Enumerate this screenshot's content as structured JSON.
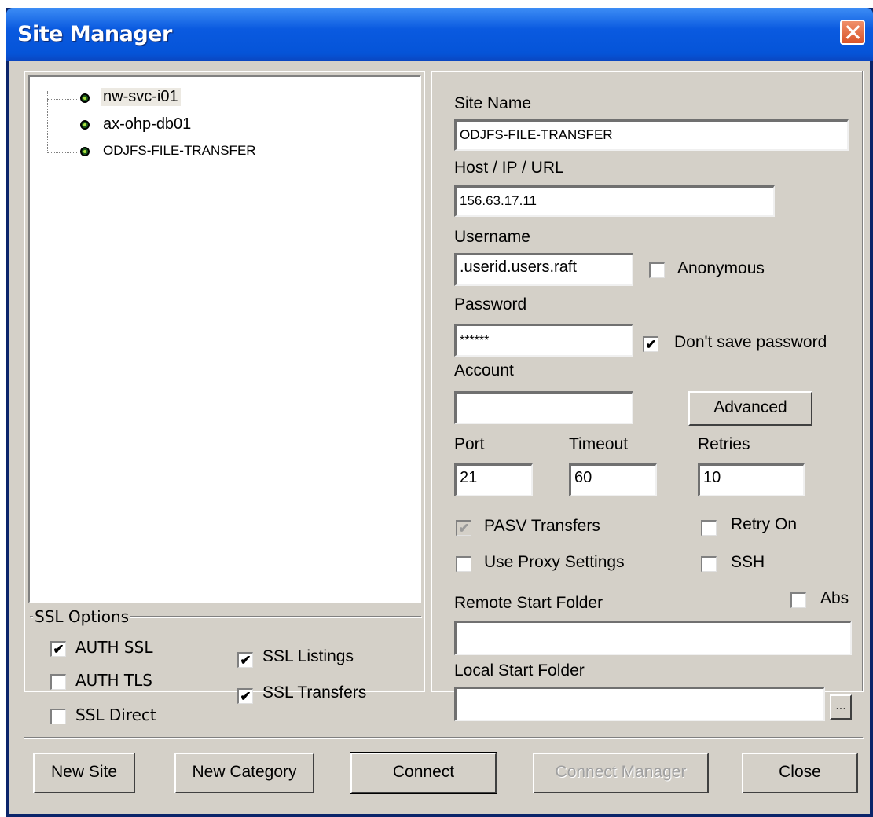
{
  "window": {
    "title": "Site Manager"
  },
  "tree": {
    "items": [
      {
        "label": "nw-svc-i01",
        "selected": true
      },
      {
        "label": "ax-ohp-db01",
        "selected": false
      },
      {
        "label": "ODJFS-FILE-TRANSFER",
        "selected": false
      }
    ]
  },
  "ssl": {
    "group_label": "SSL Options",
    "auth_ssl": {
      "label": "AUTH SSL",
      "checked": true
    },
    "auth_tls": {
      "label": "AUTH TLS",
      "checked": false
    },
    "ssl_direct": {
      "label": "SSL Direct",
      "checked": false
    },
    "ssl_listings": {
      "label": "SSL Listings",
      "checked": true
    },
    "ssl_transfers": {
      "label": "SSL Transfers",
      "checked": true
    },
    "check_glyph": "✔"
  },
  "form": {
    "site_name_label": "Site Name",
    "site_name_value": "ODJFS-FILE-TRANSFER",
    "host_label": "Host / IP / URL",
    "host_value": "156.63.17.11",
    "username_label": "Username",
    "username_value": ".userid.users.raft",
    "anonymous_label": "Anonymous",
    "password_label": "Password",
    "password_value": "******",
    "dont_save_label": "Don't save password",
    "account_label": "Account",
    "account_value": "",
    "advanced_label": "Advanced",
    "port_label": "Port",
    "port_value": "21",
    "timeout_label": "Timeout",
    "timeout_value": "60",
    "retries_label": "Retries",
    "retries_value": "10",
    "pasv_label": "PASV Transfers",
    "retry_on_label": "Retry On",
    "proxy_label": "Use Proxy Settings",
    "ssh_label": "SSH",
    "remote_folder_label": "Remote Start Folder",
    "remote_folder_value": "",
    "abs_label": "Abs",
    "local_folder_label": "Local Start Folder",
    "local_folder_value": "",
    "browse_label": "..."
  },
  "buttons": {
    "new_site": "New Site",
    "new_category": "New Category",
    "connect": "Connect",
    "connect_manager": "Connect Manager",
    "close": "Close"
  },
  "colors": {
    "title_bar": "#0554d8",
    "dialog_face": "#d4d0c8",
    "close_button": "#d8542a"
  }
}
